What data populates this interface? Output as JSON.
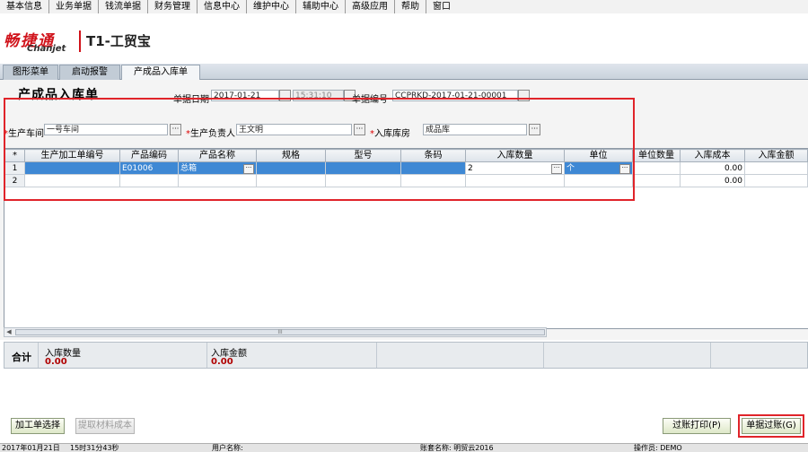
{
  "menu": [
    "基本信息",
    "业务单据",
    "钱流单据",
    "财务管理",
    "信息中心",
    "维护中心",
    "辅助中心",
    "高级应用",
    "帮助",
    "窗口"
  ],
  "brand": {
    "logo_cn": "畅捷通",
    "logo_en": "Chanjet",
    "product": "T1-工贸宝"
  },
  "tabs": [
    "图形菜单",
    "启动报警",
    "产成品入库单"
  ],
  "form": {
    "title": "产成品入库单",
    "date_label": "单据日期",
    "date_value": "2017-01-21",
    "time_value": "15:31:10",
    "docno_label": "单据编号",
    "docno_value": "CCPRKD-2017-01-21-00001",
    "workshop_label": "生产车间",
    "workshop_value": "一号车间",
    "manager_label": "生产负责人",
    "manager_value": "王文明",
    "warehouse_label": "入库库房",
    "warehouse_value": "成品库",
    "required_mark": "*",
    "ref_glyph": "···"
  },
  "grid": {
    "columns": [
      "*",
      "生产加工单编号",
      "产品编码",
      "产品名称",
      "规格",
      "型号",
      "条码",
      "入库数量",
      "单位",
      "单位数量",
      "入库成本",
      "入库金额"
    ],
    "rows": [
      {
        "no": "1",
        "order": "",
        "code": "E01006",
        "name": "总箱",
        "spec": "",
        "model": "",
        "barcode": "",
        "qty": "2",
        "unit": "个",
        "unit_qty": "",
        "cost": "0.00",
        "amount": ""
      },
      {
        "no": "2",
        "order": "",
        "code": "",
        "name": "",
        "spec": "",
        "model": "",
        "barcode": "",
        "qty": "",
        "unit": "",
        "unit_qty": "",
        "cost": "0.00",
        "amount": ""
      }
    ]
  },
  "scroll_glyph": "III",
  "totals": {
    "label": "合计",
    "qty_label": "入库数量",
    "qty_value": "0.00",
    "amount_label": "入库金额",
    "amount_value": "0.00"
  },
  "buttons": {
    "select_order": "加工单选择",
    "material_cost": "提取材料成本",
    "print_post": "过账打印(P)",
    "post": "单据过账(G)"
  },
  "status": {
    "date": "2017年01月21日",
    "time": "15时31分43秒",
    "user": "用户名称:",
    "account": "账套名称: 明贸云2016",
    "operator": "操作员: DEMO"
  },
  "colors": {
    "accent_red": "#e0242a",
    "selection": "#3e88d4",
    "total_value": "#b00000"
  }
}
